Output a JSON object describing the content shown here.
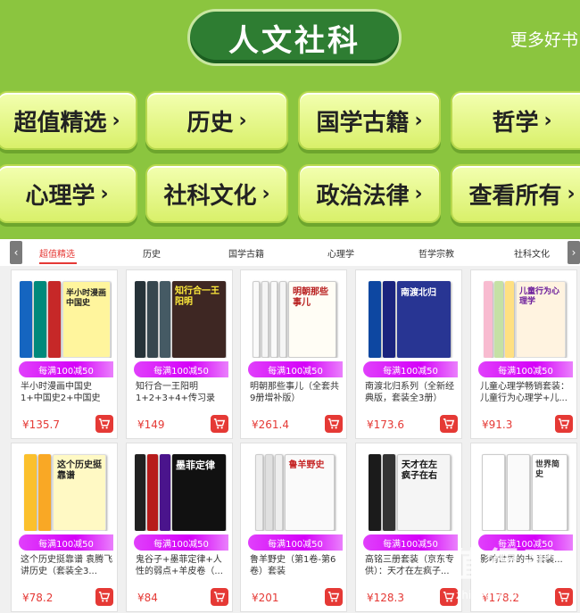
{
  "header": {
    "title": "人文社科",
    "more": "更多好书"
  },
  "categories": [
    {
      "label": "超值精选",
      "chevron": "›"
    },
    {
      "label": "历史",
      "chevron": "›"
    },
    {
      "label": "国学古籍",
      "chevron": "›"
    },
    {
      "label": "哲学",
      "chevron": "›"
    },
    {
      "label": "心理学",
      "chevron": "›"
    },
    {
      "label": "社科文化",
      "chevron": "›"
    },
    {
      "label": "政治法律",
      "chevron": "›"
    },
    {
      "label": "查看所有",
      "chevron": "›"
    }
  ],
  "tabs": {
    "left_arrow": "‹",
    "right_arrow": "›",
    "items": [
      "超值精选",
      "历史",
      "国学古籍",
      "心理学",
      "哲学宗教",
      "社科文化"
    ],
    "active_index": 0
  },
  "colors": {
    "background": "#8bc53f",
    "title_pill": "#2e7d32",
    "accent_red": "#e53935",
    "promo_purple": "#d500f9"
  },
  "products": [
    {
      "promo": "每满100减50",
      "name": "半小时漫画中国史1+中国史2+中国史3...",
      "price": "¥135.7",
      "cover_title": "半小时漫画中国史"
    },
    {
      "promo": "每满100减50",
      "name": "知行合一王阳明1+2+3+4+传习录（套装共...",
      "price": "¥149",
      "cover_title": "知行合一王阳明"
    },
    {
      "promo": "每满100减50",
      "name": "明朝那些事儿（全套共9册增补版）",
      "price": "¥261.4",
      "cover_title": "明朝那些事儿"
    },
    {
      "promo": "每满100减50",
      "name": "南渡北归系列（全新经典版，套装全3册）",
      "price": "¥173.6",
      "cover_title": "南渡北归"
    },
    {
      "promo": "每满100减50",
      "name": "儿童心理学畅销套装：儿童行为心理学+儿...",
      "price": "¥91.3",
      "cover_title": "儿童行为心理学"
    },
    {
      "promo": "每满100减50",
      "name": "这个历史挺靠谱 袁腾飞讲历史（套装全3...",
      "price": "¥78.2",
      "cover_title": "这个历史挺靠谱"
    },
    {
      "promo": "每满100减50",
      "name": "鬼谷子+墨菲定律+人性的弱点+羊皮卷（...",
      "price": "¥84",
      "cover_title": "墨菲定律"
    },
    {
      "promo": "每满100减50",
      "name": "鲁羊野史（第1卷-第6卷）套装",
      "price": "¥201",
      "cover_title": "鲁羊野史"
    },
    {
      "promo": "每满100减50",
      "name": "高铭三册套装（京东专供）：天才在左疯子...",
      "price": "¥128.3",
      "cover_title": "天才在左 疯子在右"
    },
    {
      "promo": "每满100减50",
      "name": "影响世界的书 套装...",
      "price": "¥178.2",
      "cover_title": "世界简史"
    }
  ],
  "watermark": {
    "logo": "值得买",
    "url": "zhidemai.com"
  }
}
